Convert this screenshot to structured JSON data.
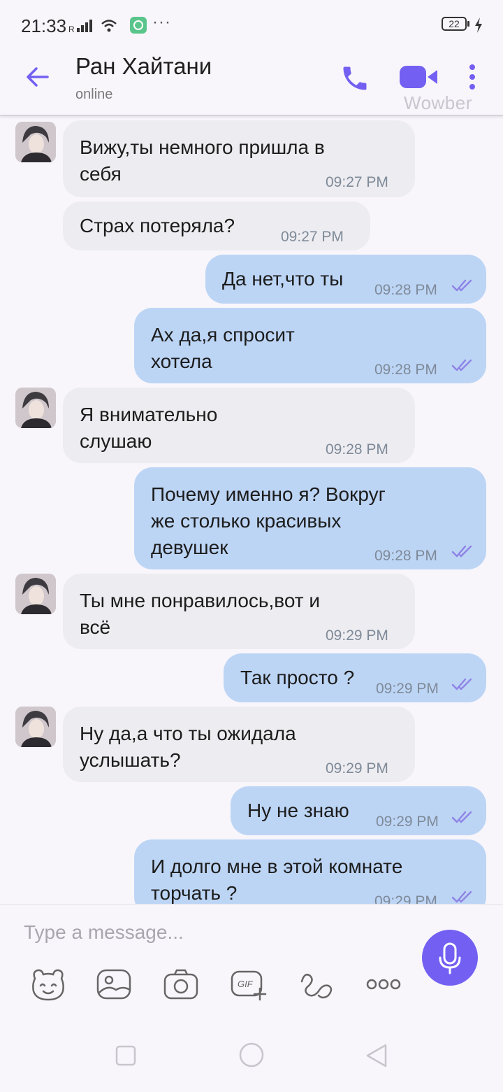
{
  "status_bar": {
    "time": "21:33",
    "battery": "22",
    "extra": "···"
  },
  "header": {
    "contact_name": "Ран Хайтани",
    "status": "online",
    "watermark": "Wowber"
  },
  "messages": [
    {
      "direction": "in",
      "text": "Вижу,ты немного пришла в\nсебя",
      "time": "09:27 PM"
    },
    {
      "direction": "in",
      "text": "Страх потеряла?",
      "time": "09:27 PM"
    },
    {
      "direction": "out",
      "text": "Да нет,что ты",
      "time": "09:28 PM"
    },
    {
      "direction": "out",
      "text": "Ах да,я спросит\nхотела",
      "time": "09:28 PM"
    },
    {
      "direction": "in",
      "text": "Я внимательно\nслушаю",
      "time": "09:28 PM"
    },
    {
      "direction": "out",
      "text": "Почему именно я? Вокруг\nже столько красивых\nдевушек",
      "time": "09:28 PM"
    },
    {
      "direction": "in",
      "text": "Ты мне понравилось,вот и\nвсё",
      "time": "09:29 PM"
    },
    {
      "direction": "out",
      "text": "Так просто ?",
      "time": "09:29 PM"
    },
    {
      "direction": "in",
      "text": "Ну да,а что ты ожидала\nуслышать?",
      "time": "09:29 PM"
    },
    {
      "direction": "out",
      "text": "Ну не знаю",
      "time": "09:29 PM"
    },
    {
      "direction": "out",
      "text": "И долго мне в этой комнате\nторчать ?",
      "time": "09:29 PM"
    }
  ],
  "composer": {
    "placeholder": "Type a message..."
  },
  "colors": {
    "accent": "#7360f2",
    "incoming_bubble": "#edecf0",
    "outgoing_bubble": "#bdd5f5",
    "read_ticks": "#8f83e6"
  },
  "icons": [
    "back-arrow-icon",
    "phone-icon",
    "video-camera-icon",
    "more-vertical-icon",
    "microphone-icon",
    "sticker-icon",
    "gallery-icon",
    "camera-icon",
    "gif-icon",
    "doodle-icon",
    "more-horizontal-icon",
    "read-ticks-icon"
  ]
}
